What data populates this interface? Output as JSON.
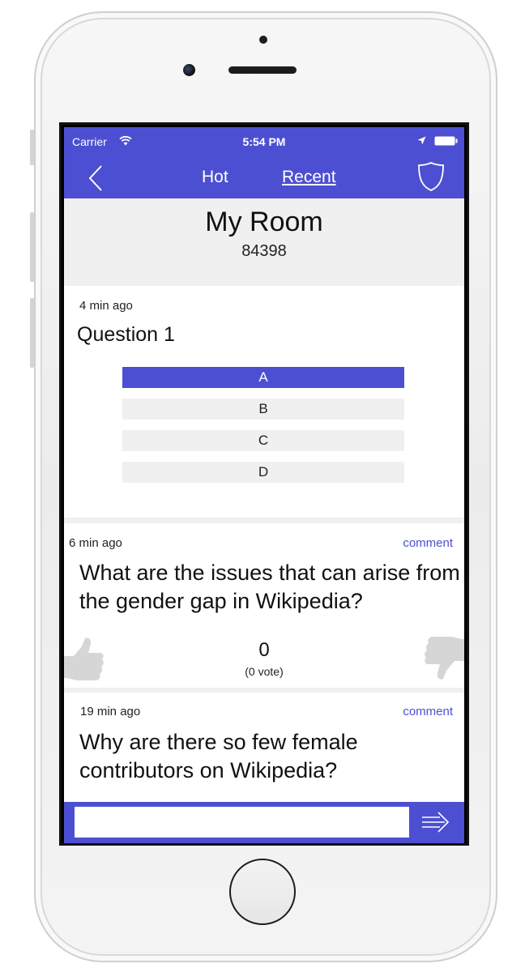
{
  "status_bar": {
    "carrier": "Carrier",
    "time": "5:54 PM",
    "icons": [
      "wifi-icon",
      "location-arrow-icon",
      "battery-icon"
    ]
  },
  "nav": {
    "back_icon": "chevron-left-icon",
    "tab_hot": "Hot",
    "tab_recent": "Recent",
    "active_tab": "Recent",
    "shield_icon": "shield-icon"
  },
  "room": {
    "title": "My Room",
    "code": "84398"
  },
  "cards": [
    {
      "time": "4 min ago",
      "question": "Question 1",
      "options": [
        "A",
        "B",
        "C",
        "D"
      ],
      "selected_option": "A"
    },
    {
      "time": "6 min ago",
      "comment_link": "comment",
      "question": "What are the issues that can arise from the gender gap in Wikipedia?",
      "vote_count": "0",
      "vote_label": "(0 vote)"
    },
    {
      "time": "19 min ago",
      "comment_link": "comment",
      "question": "Why are there so few female contributors on Wikipedia?"
    }
  ],
  "input_bar": {
    "value": "",
    "send_icon": "send-arrow-icon"
  },
  "colors": {
    "accent": "#4d4fd2",
    "panel_gray": "#f0f0f0",
    "text": "#111111",
    "thumb_gray": "#d6d6d6"
  }
}
